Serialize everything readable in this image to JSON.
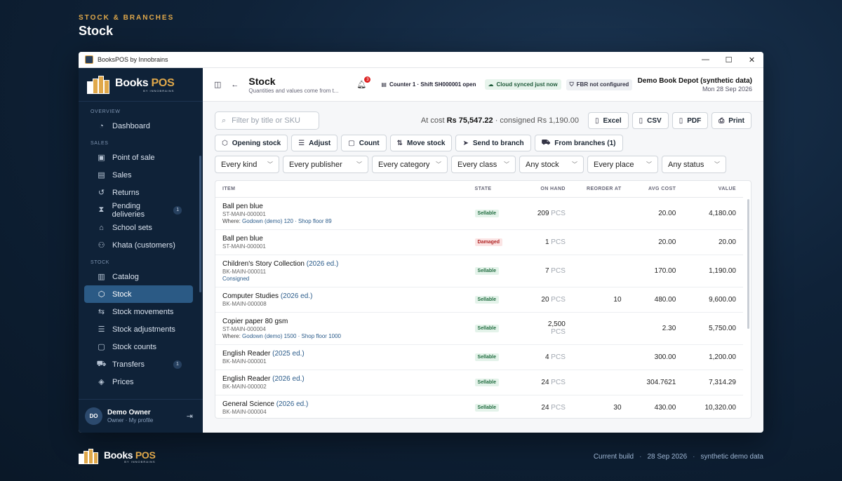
{
  "page": {
    "kicker": "STOCK & BRANCHES",
    "heading": "Stock"
  },
  "window": {
    "title": "BooksPOS by Innobrains"
  },
  "brand": {
    "name_main": "Books ",
    "name_accent": "POS",
    "sub": "BY INNOBRAINS"
  },
  "sidebar": {
    "sections": {
      "overview": "OVERVIEW",
      "sales": "SALES",
      "stock": "STOCK"
    },
    "items": [
      {
        "label": "Dashboard",
        "icon": "dashboard-icon"
      },
      {
        "label": "Point of sale",
        "icon": "pos-icon"
      },
      {
        "label": "Sales",
        "icon": "sales-icon"
      },
      {
        "label": "Returns",
        "icon": "returns-icon"
      },
      {
        "label": "Pending deliveries",
        "icon": "hourglass-icon",
        "badge": "1"
      },
      {
        "label": "School sets",
        "icon": "school-icon"
      },
      {
        "label": "Khata (customers)",
        "icon": "customers-icon"
      },
      {
        "label": "Catalog",
        "icon": "catalog-icon"
      },
      {
        "label": "Stock",
        "icon": "box-icon"
      },
      {
        "label": "Stock movements",
        "icon": "movements-icon"
      },
      {
        "label": "Stock adjustments",
        "icon": "sliders-icon"
      },
      {
        "label": "Stock counts",
        "icon": "clipboard-icon"
      },
      {
        "label": "Transfers",
        "icon": "truck-icon",
        "badge": "1"
      },
      {
        "label": "Prices",
        "icon": "tag-icon"
      }
    ]
  },
  "user": {
    "initials": "DO",
    "name": "Demo Owner",
    "role": "Owner · My profile"
  },
  "topbar": {
    "title": "Stock",
    "subtitle": "Quantities and values come from t...",
    "notifications": "3",
    "counter": "Counter 1 · Shift SH000001 open",
    "cloud": "Cloud synced just now",
    "fbr": "FBR not configured",
    "depot": "Demo Book Depot (synthetic data)",
    "date": "Mon 28 Sep 2026"
  },
  "toolbar": {
    "search_placeholder": "Filter by title or SKU",
    "totals_prefix": "At cost ",
    "totals_value": "Rs 75,547.22",
    "totals_suffix": " · consigned Rs 1,190.00",
    "export": {
      "excel": "Excel",
      "csv": "CSV",
      "pdf": "PDF",
      "print": "Print"
    },
    "actions": {
      "opening": "Opening stock",
      "adjust": "Adjust",
      "count": "Count",
      "move": "Move stock",
      "send": "Send to branch",
      "from": "From branches (1)"
    },
    "filters": [
      "Every kind",
      "Every publisher",
      "Every category",
      "Every class",
      "Any stock",
      "Every place",
      "Any status"
    ]
  },
  "table": {
    "headers": {
      "item": "ITEM",
      "state": "STATE",
      "on_hand": "ON HAND",
      "reorder": "REORDER AT",
      "avg_cost": "AVG COST",
      "value": "VALUE"
    },
    "unit": "PCS",
    "where_label": "Where: ",
    "rows": [
      {
        "name": "Ball pen blue",
        "edition": "",
        "sku": "ST-MAIN-000001",
        "where": "Godown (demo) 120 · Shop floor 89",
        "extra": "",
        "state": "Sellable",
        "qty": "209",
        "reorder": "",
        "avg": "20.00",
        "value": "4,180.00"
      },
      {
        "name": "Ball pen blue",
        "edition": "",
        "sku": "ST-MAIN-000001",
        "where": "",
        "extra": "",
        "state": "Damaged",
        "qty": "1",
        "reorder": "",
        "avg": "20.00",
        "value": "20.00"
      },
      {
        "name": "Children's Story Collection",
        "edition": " (2026 ed.)",
        "sku": "BK-MAIN-000011",
        "where": "",
        "extra": "Consigned",
        "state": "Sellable",
        "qty": "7",
        "reorder": "",
        "avg": "170.00",
        "value": "1,190.00"
      },
      {
        "name": "Computer Studies",
        "edition": " (2026 ed.)",
        "sku": "BK-MAIN-000008",
        "where": "",
        "extra": "",
        "state": "Sellable",
        "qty": "20",
        "reorder": "10",
        "avg": "480.00",
        "value": "9,600.00"
      },
      {
        "name": "Copier paper 80 gsm",
        "edition": "",
        "sku": "ST-MAIN-000004",
        "where": "Godown (demo) 1500 · Shop floor 1000",
        "extra": "",
        "state": "Sellable",
        "qty": "2,500",
        "reorder": "",
        "avg": "2.30",
        "value": "5,750.00"
      },
      {
        "name": "English Reader",
        "edition": " (2025 ed.)",
        "sku": "BK-MAIN-000001",
        "where": "",
        "extra": "",
        "state": "Sellable",
        "qty": "4",
        "reorder": "",
        "avg": "300.00",
        "value": "1,200.00"
      },
      {
        "name": "English Reader",
        "edition": " (2026 ed.)",
        "sku": "BK-MAIN-000002",
        "where": "",
        "extra": "",
        "state": "Sellable",
        "qty": "24",
        "reorder": "",
        "avg": "304.7621",
        "value": "7,314.29"
      },
      {
        "name": "General Science",
        "edition": " (2026 ed.)",
        "sku": "BK-MAIN-000004",
        "where": "",
        "extra": "",
        "state": "Sellable",
        "qty": "24",
        "reorder": "30",
        "avg": "430.00",
        "value": "10,320.00"
      }
    ]
  },
  "footer": {
    "build_label": "Current build",
    "build_date": "28 Sep 2026",
    "data_label": "synthetic demo data"
  },
  "colors": {
    "accent": "#e0a84a",
    "sidebar_bg": "#0f2238",
    "active_nav": "#2b5a85"
  }
}
